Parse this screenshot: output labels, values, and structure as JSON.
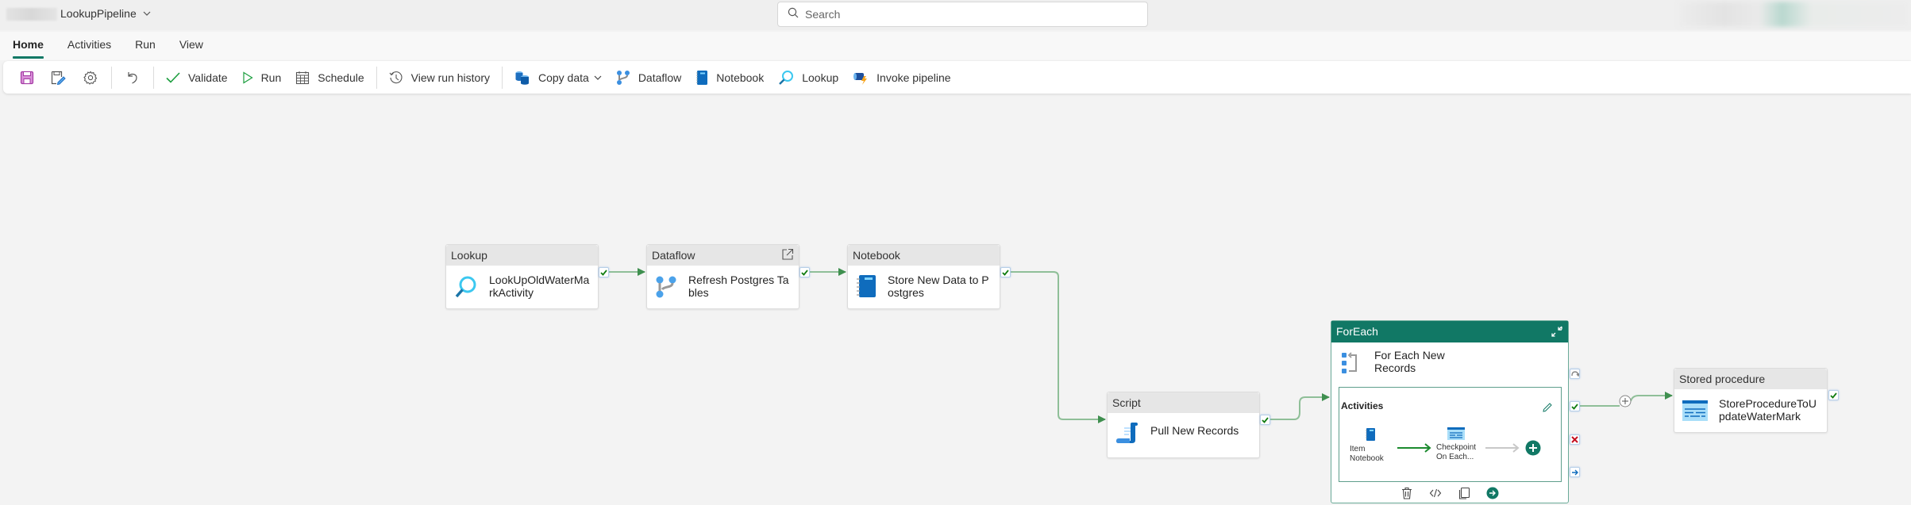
{
  "header": {
    "pipeline_name": "LookupPipeline",
    "search_placeholder": "Search"
  },
  "tabs": [
    {
      "label": "Home",
      "active": true
    },
    {
      "label": "Activities",
      "active": false
    },
    {
      "label": "Run",
      "active": false
    },
    {
      "label": "View",
      "active": false
    }
  ],
  "toolbar": {
    "icon_buttons": [
      "save-icon",
      "save-as-template-icon",
      "settings-icon",
      "undo-icon"
    ],
    "validate": "Validate",
    "run": "Run",
    "schedule": "Schedule",
    "view_run_history": "View run history",
    "copy_data": "Copy data",
    "dataflow": "Dataflow",
    "notebook": "Notebook",
    "lookup": "Lookup",
    "invoke_pipeline": "Invoke pipeline"
  },
  "colors": {
    "accent": "#117865",
    "connector": "#3f8f4f",
    "success": "#107c10",
    "failure": "#c50f1f",
    "completion": "#0f6cbd"
  },
  "pipeline": {
    "activities": [
      {
        "type": "Lookup",
        "name": "LookUpOldWaterMarkActivity",
        "icon": "lookup-icon"
      },
      {
        "type": "Dataflow",
        "name": "Refresh Postgres Tables",
        "icon": "dataflow-icon"
      },
      {
        "type": "Notebook",
        "name": "Store New Data to Postgres",
        "icon": "notebook-icon"
      },
      {
        "type": "Script",
        "name": "Pull New Records",
        "icon": "script-icon"
      },
      {
        "type": "Stored procedure",
        "name": "StoreProcedureToUpdateWaterMark",
        "icon": "stored-procedure-icon"
      }
    ],
    "foreach": {
      "type": "ForEach",
      "name": "For Each New Records",
      "activities_title": "Activities",
      "inner_activities": [
        {
          "name": "Item Notebook",
          "icon": "notebook-icon"
        },
        {
          "name": "Checkpoint On Each...",
          "icon": "stored-procedure-icon"
        }
      ]
    }
  }
}
